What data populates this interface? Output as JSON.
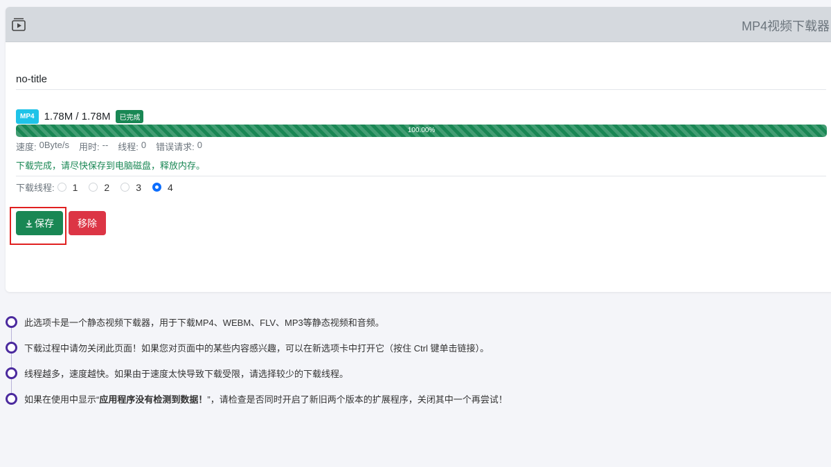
{
  "header": {
    "title": "MP4视频下载器",
    "icon": "video-player-icon"
  },
  "download": {
    "title": "no-title",
    "format_badge": "MP4",
    "size_text": "1.78M / 1.78M",
    "status_badge": "已完成",
    "progress_percent": 100,
    "progress_label": "100.00%",
    "stats": [
      {
        "label": "速度:",
        "value": "0Byte/s"
      },
      {
        "label": "用时:",
        "value": "--"
      },
      {
        "label": "线程:",
        "value": "0"
      },
      {
        "label": "错误请求:",
        "value": "0"
      }
    ],
    "message": "下载完成，请尽快保存到电脑磁盘，释放内存。",
    "threads_label": "下载线程:",
    "thread_options": [
      "1",
      "2",
      "3",
      "4"
    ],
    "selected_thread": "4",
    "save_label": "保存",
    "remove_label": "移除"
  },
  "notes": {
    "items": [
      {
        "text": "此选项卡是一个静态视频下载器，用于下载MP4、WEBM、FLV、MP3等静态视频和音频。"
      },
      {
        "text": "下载过程中请勿关闭此页面！如果您对页面中的某些内容感兴趣，可以在新选项卡中打开它（按住 Ctrl 键单击链接）。"
      },
      {
        "text": "线程越多，速度越快。如果由于速度太快导致下载受限，请选择较少的下载线程。"
      }
    ],
    "last": {
      "pre": "如果在使用中显示“",
      "bold": "应用程序没有检测到数据！",
      "post": "”，请检查是否同时开启了新旧两个版本的扩展程序，关闭其中一个再尝试！"
    }
  },
  "colors": {
    "success": "#198754",
    "danger": "#dc3545",
    "info": "#1fc3e8",
    "timeline": "#4b2a9e"
  }
}
